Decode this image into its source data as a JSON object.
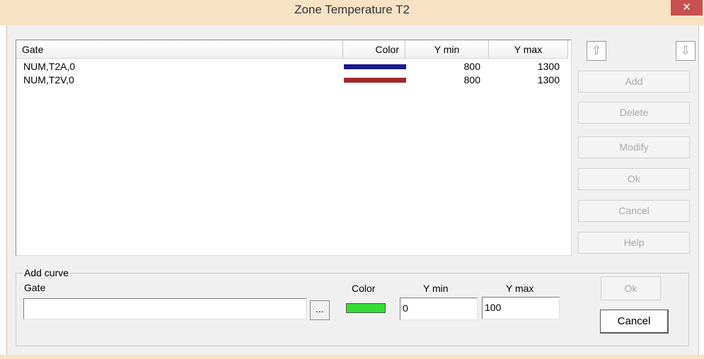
{
  "window": {
    "title": "Zone Temperature T2",
    "close_label": "✕"
  },
  "list": {
    "columns": [
      "Gate",
      "Color",
      "Y min",
      "Y max"
    ],
    "rows": [
      {
        "gate": "NUM,T2A,0",
        "color": "#1a1a8c",
        "ymin": "800",
        "ymax": "1300"
      },
      {
        "gate": "NUM,T2V,0",
        "color": "#a02828",
        "ymin": "800",
        "ymax": "1300"
      }
    ]
  },
  "side": {
    "up_arrow": "⇧",
    "down_arrow": "⇩",
    "buttons": [
      "Add",
      "Delete",
      "Modify",
      "Ok",
      "Cancel",
      "Help"
    ]
  },
  "add_curve": {
    "title": "Add curve",
    "gate_label": "Gate",
    "gate_value": "",
    "browse_label": "...",
    "color_label": "Color",
    "color_value": "#33dd33",
    "ymin_label": "Y min",
    "ymin_value": "0",
    "ymax_label": "Y max",
    "ymax_value": "100",
    "ok_label": "Ok",
    "cancel_label": "Cancel"
  }
}
